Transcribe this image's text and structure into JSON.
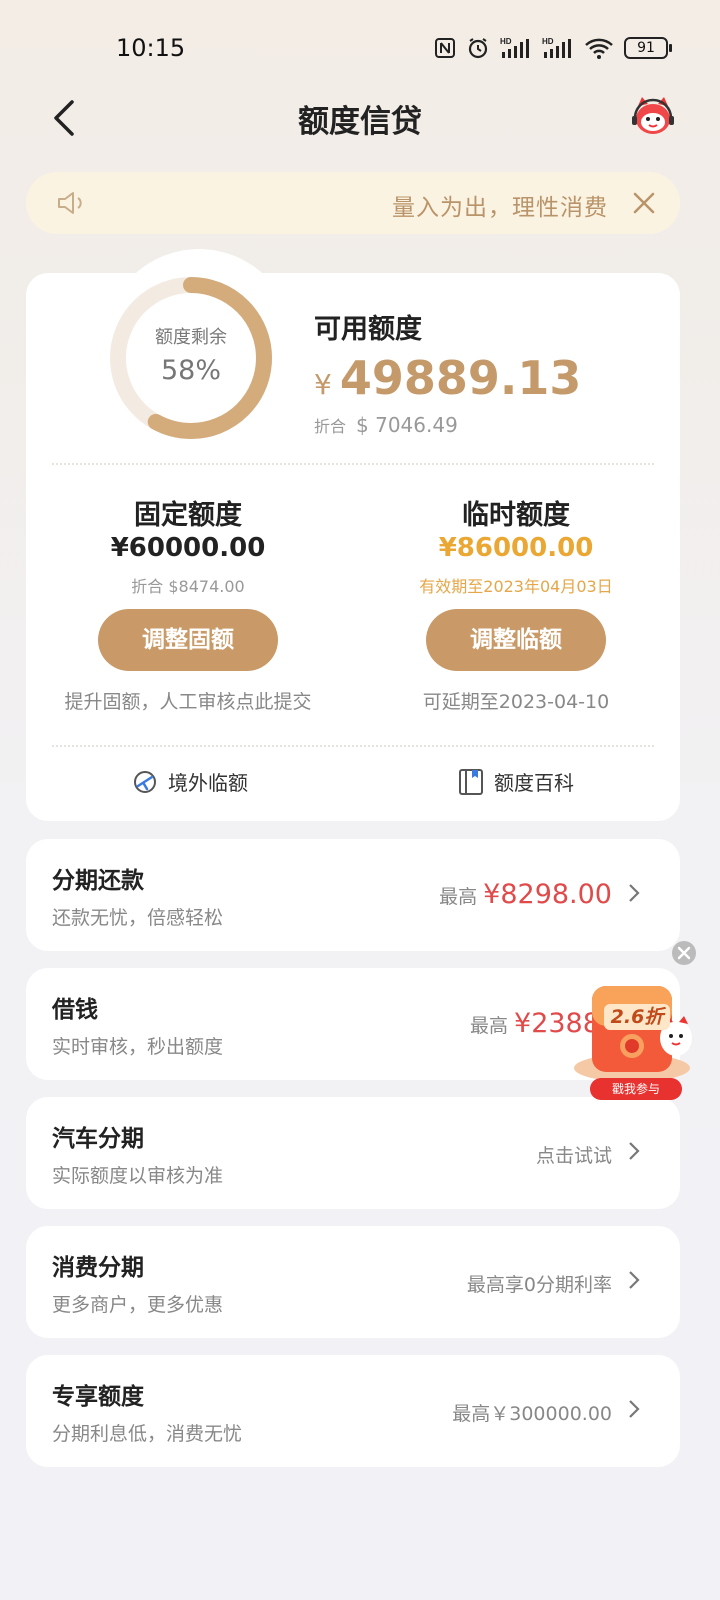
{
  "status_bar": {
    "time": "10:15",
    "battery": "91"
  },
  "nav": {
    "title": "额度信贷"
  },
  "notice": {
    "text": "量入为出，理性消费"
  },
  "quota": {
    "ring_label": "额度剩余",
    "ring_percent": "58%",
    "ring_fraction": 0.58,
    "available_title": "可用额度",
    "available_currency": "¥",
    "available_amount": "49889.13",
    "converted_label": "折合",
    "converted_amount": "$ 7046.49",
    "fixed": {
      "title": "固定额度",
      "amount": "¥60000.00",
      "sub": "折合 $8474.00",
      "button": "调整固额",
      "hint": "提升固额，人工审核点此提交"
    },
    "temp": {
      "title": "临时额度",
      "amount": "¥86000.00",
      "sub": "有效期至2023年04月03日",
      "button": "调整临额",
      "hint": "可延期至2023-04-10"
    },
    "links": [
      {
        "label": "境外临额",
        "icon": "plane-globe-icon"
      },
      {
        "label": "额度百科",
        "icon": "book-icon"
      }
    ]
  },
  "items": [
    {
      "title": "分期还款",
      "sub": "还款无忧，倍感轻松",
      "prefix": "最高",
      "value": "¥8298.00"
    },
    {
      "title": "借钱",
      "sub": "实时审核，秒出额度",
      "prefix": "最高",
      "value": "¥2388"
    },
    {
      "title": "汽车分期",
      "sub": "实际额度以审核为准",
      "prefix": "",
      "value": "点击试试"
    },
    {
      "title": "消费分期",
      "sub": "更多商户，更多优惠",
      "prefix": "",
      "value": "最高享0分期利率"
    },
    {
      "title": "专享额度",
      "sub": "分期利息低，消费无忧",
      "prefix": "",
      "value": "最高￥300000.00"
    }
  ],
  "promo": {
    "discount": "2.6折",
    "cta": "戳我参与"
  },
  "colors": {
    "gold": "#c99a67",
    "orange": "#eaa733",
    "red": "#e04a4a"
  }
}
